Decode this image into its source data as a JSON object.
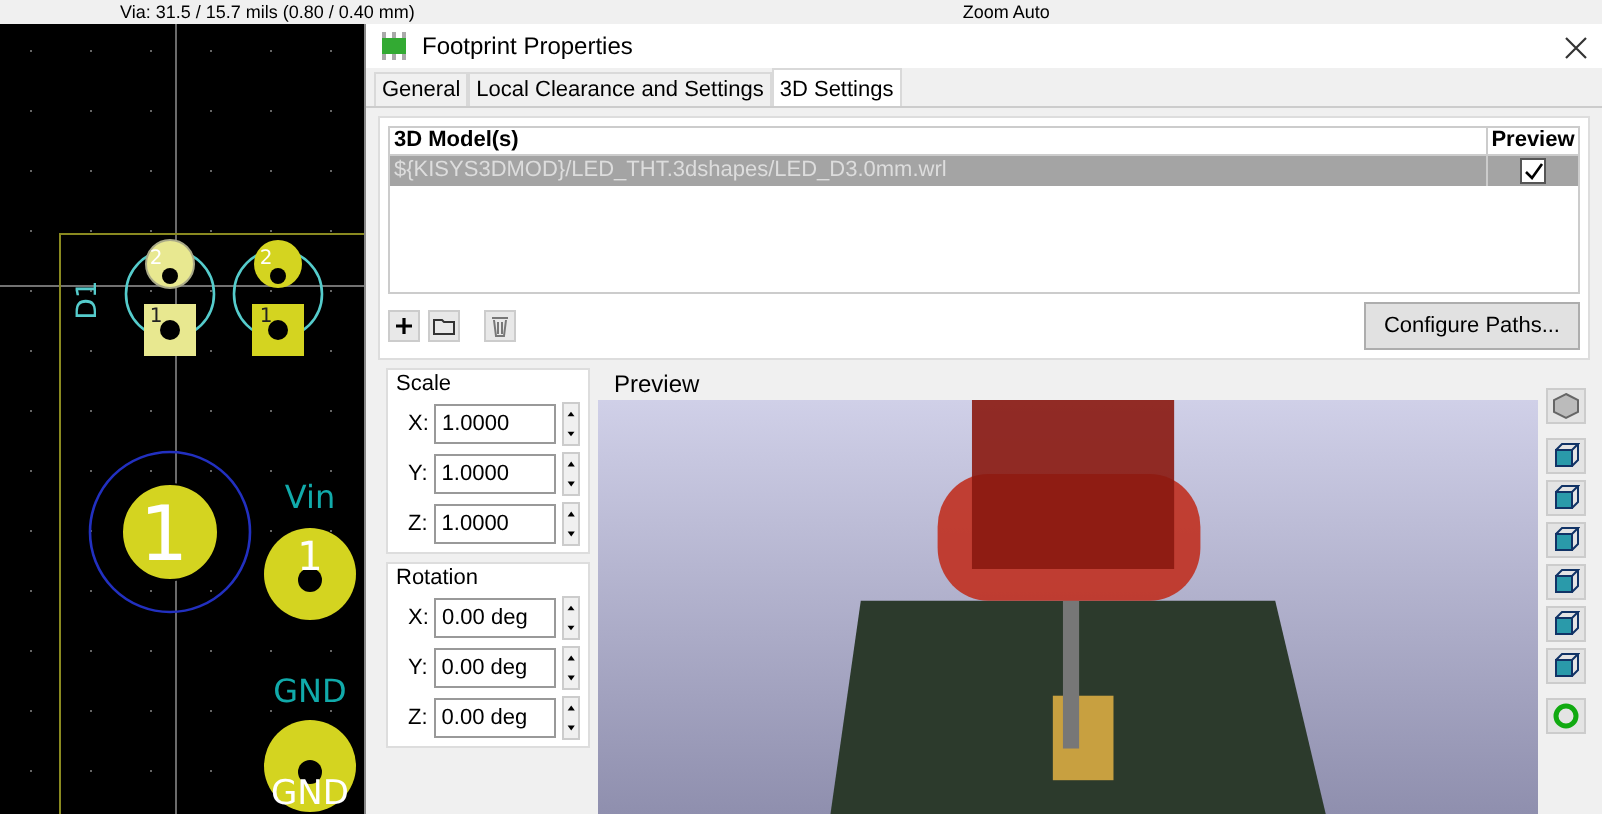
{
  "toolbar": {
    "via": "Via: 31.5 / 15.7 mils (0.80 / 0.40 mm)",
    "zoom": "Zoom Auto"
  },
  "pcb": {
    "reference": "D1",
    "pads": [
      "2",
      "1",
      "2",
      "1",
      "1",
      "1"
    ],
    "net_labels": [
      "Vin",
      "GND"
    ],
    "pad_net": "GND"
  },
  "dialog": {
    "title": "Footprint Properties",
    "tabs": [
      {
        "label": "General",
        "selected": false
      },
      {
        "label": "Local Clearance and Settings",
        "selected": false
      },
      {
        "label": "3D Settings",
        "selected": true
      }
    ],
    "models": {
      "columns": [
        "3D Model(s)",
        "Preview"
      ],
      "rows": [
        {
          "path": "${KISYS3DMOD}/LED_THT.3dshapes/LED_D3.0mm.wrl",
          "preview": true,
          "selected": true
        }
      ]
    },
    "configure_button": "Configure Paths...",
    "scale": {
      "title": "Scale",
      "fields": [
        {
          "label": "X:",
          "value": "1.0000"
        },
        {
          "label": "Y:",
          "value": "1.0000"
        },
        {
          "label": "Z:",
          "value": "1.0000"
        }
      ]
    },
    "rotation": {
      "title": "Rotation",
      "fields": [
        {
          "label": "X:",
          "value": "0.00 deg"
        },
        {
          "label": "Y:",
          "value": "0.00 deg"
        },
        {
          "label": "Z:",
          "value": "0.00 deg"
        }
      ]
    },
    "preview": {
      "title": "Preview"
    }
  }
}
